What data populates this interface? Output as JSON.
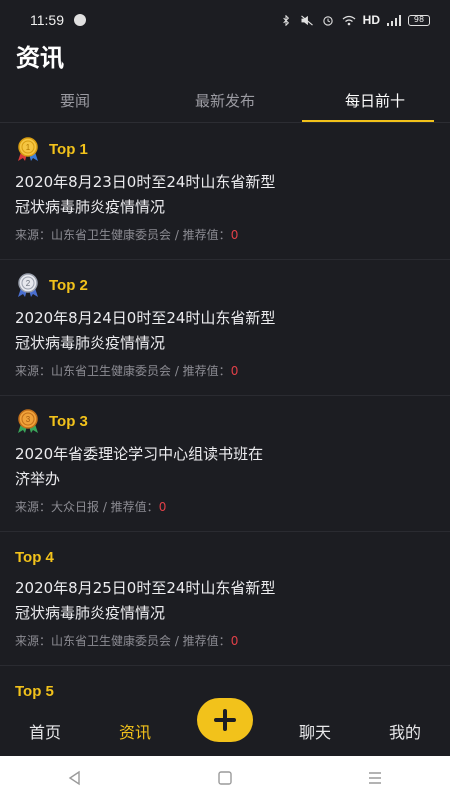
{
  "status_bar": {
    "time": "11:59",
    "network": "HD",
    "battery": "98"
  },
  "page": {
    "title": "资讯"
  },
  "tabs": [
    {
      "label": "要闻",
      "active": false
    },
    {
      "label": "最新发布",
      "active": false
    },
    {
      "label": "每日前十",
      "active": true
    }
  ],
  "articles": [
    {
      "rank_label": "Top 1",
      "medal": "gold-medal-icon",
      "title_line1": "2020年8月23日0时至24时山东省新型",
      "title_line2": "冠状病毒肺炎疫情情况",
      "meta_prefix": "来源：山东省卫生健康委员会 / 推荐值：",
      "score": "0"
    },
    {
      "rank_label": "Top 2",
      "medal": "silver-medal-icon",
      "title_line1": "2020年8月24日0时至24时山东省新型",
      "title_line2": "冠状病毒肺炎疫情情况",
      "meta_prefix": "来源：山东省卫生健康委员会 / 推荐值：",
      "score": "0"
    },
    {
      "rank_label": "Top 3",
      "medal": "bronze-medal-icon",
      "title_line1": "2020年省委理论学习中心组读书班在",
      "title_line2": "济举办",
      "meta_prefix": "来源：大众日报 / 推荐值：",
      "score": "0"
    },
    {
      "rank_label": "Top 4",
      "title_line1": "2020年8月25日0时至24时山东省新型",
      "title_line2": "冠状病毒肺炎疫情情况",
      "meta_prefix": "来源：山东省卫生健康委员会 / 推荐值：",
      "score": "0"
    },
    {
      "rank_label": "Top 5"
    }
  ],
  "bottom_nav": {
    "home": "首页",
    "news": "资讯",
    "chat": "聊天",
    "mine": "我的",
    "add_icon": "plus-icon"
  },
  "colors": {
    "accent": "#f2c21b",
    "background": "#1c1d22",
    "score": "#e04048"
  }
}
